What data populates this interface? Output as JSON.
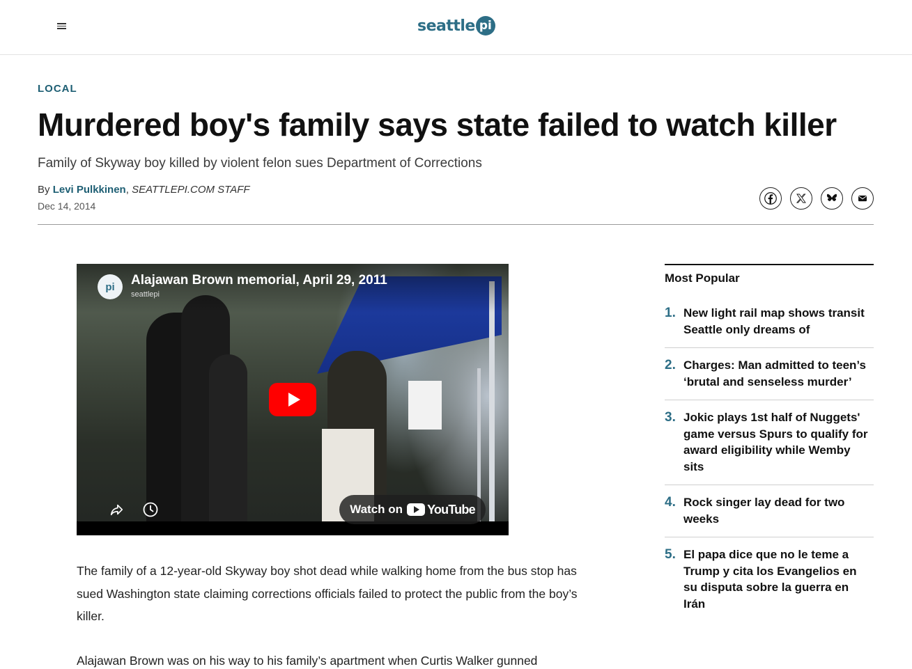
{
  "header": {
    "logo_text": "seattle",
    "logo_badge": "pi",
    "brand_color": "#2d6e86"
  },
  "article": {
    "section": "LOCAL",
    "headline": "Murdered boy's family says state failed to watch killer",
    "dek": "Family of Skyway boy killed by violent felon sues Department of Corrections",
    "byline_prefix": "By",
    "author": "Levi Pulkkinen",
    "author_title": "SEATTLEPI.COM STAFF",
    "date": "Dec 14, 2014",
    "share_icons": [
      "facebook-icon",
      "x-icon",
      "bluesky-icon",
      "email-icon"
    ],
    "paragraphs": [
      "The family of a 12-year-old Skyway boy shot dead while walking home from the bus stop has sued Washington state claiming corrections officials failed to protect the public from the boy’s killer.",
      "Alajawan Brown was on his way to his family’s apartment when Curtis Walker gunned"
    ]
  },
  "video": {
    "title": "Alajawan Brown memorial, April 29, 2011",
    "channel": "seattlepi",
    "channel_avatar": "pi",
    "watch_on": "Watch on",
    "youtube": "YouTube"
  },
  "sidebar": {
    "title": "Most Popular",
    "items": [
      {
        "num": "1.",
        "text": "New light rail map shows transit Seattle only dreams of"
      },
      {
        "num": "2.",
        "text": "Charges: Man admitted to teen’s ‘brutal and senseless murder’"
      },
      {
        "num": "3.",
        "text": "Jokic plays 1st half of Nuggets' game versus Spurs to qualify for award eligibility while Wemby sits"
      },
      {
        "num": "4.",
        "text": "Rock singer lay dead for two weeks"
      },
      {
        "num": "5.",
        "text": "El papa dice que no le teme a Trump y cita los Evangelios en su disputa sobre la guerra en Irán"
      }
    ]
  }
}
